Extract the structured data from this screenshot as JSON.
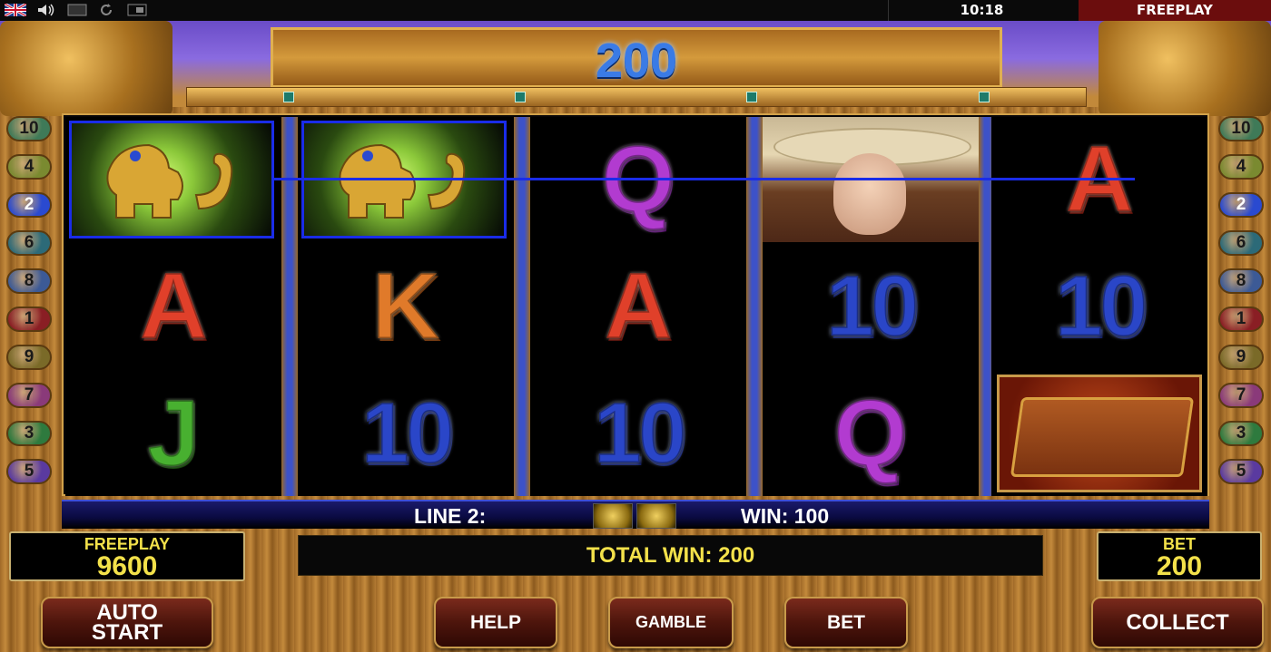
{
  "topbar": {
    "icons": [
      "uk-flag-icon",
      "sound-icon",
      "fullscreen-icon",
      "refresh-icon",
      "window-icon"
    ],
    "time": "10:18",
    "mode": "FREEPLAY"
  },
  "header": {
    "win_amount": "200"
  },
  "line_buttons": {
    "left": [
      "10",
      "4",
      "2",
      "6",
      "8",
      "1",
      "9",
      "7",
      "3",
      "5"
    ],
    "right": [
      "10",
      "4",
      "2",
      "6",
      "8",
      "1",
      "9",
      "7",
      "3",
      "5"
    ],
    "active": "2"
  },
  "reels": [
    [
      "jaguar",
      "A",
      "J"
    ],
    [
      "jaguar",
      "K",
      "10"
    ],
    [
      "Q",
      "A",
      "10"
    ],
    [
      "woman",
      "10",
      "Q"
    ],
    [
      "A",
      "10",
      "book"
    ]
  ],
  "info": {
    "line_text": "LINE 2:",
    "win_text": "WIN: 100"
  },
  "credits": {
    "label": "FREEPLAY",
    "value": "9600"
  },
  "total_win": "TOTAL WIN: 200",
  "bet_panel": {
    "label": "BET",
    "value": "200"
  },
  "buttons": {
    "auto_start_line1": "AUTO",
    "auto_start_line2": "START",
    "help": "HELP",
    "gamble": "GAMBLE",
    "bet": "BET",
    "collect": "COLLECT"
  },
  "colors": {
    "line_buttons": {
      "10": "#3f7a58",
      "4": "#7a8a30",
      "2": "#2a4ad0",
      "6": "#2c6a78",
      "8": "#3c5a96",
      "1": "#8a1e24",
      "9": "#7a6a28",
      "7": "#8a3a7a",
      "3": "#2e7a3e",
      "5": "#5a3aa0"
    },
    "highlight": "#1a2ce8",
    "text_yellow": "#f3e14a"
  }
}
